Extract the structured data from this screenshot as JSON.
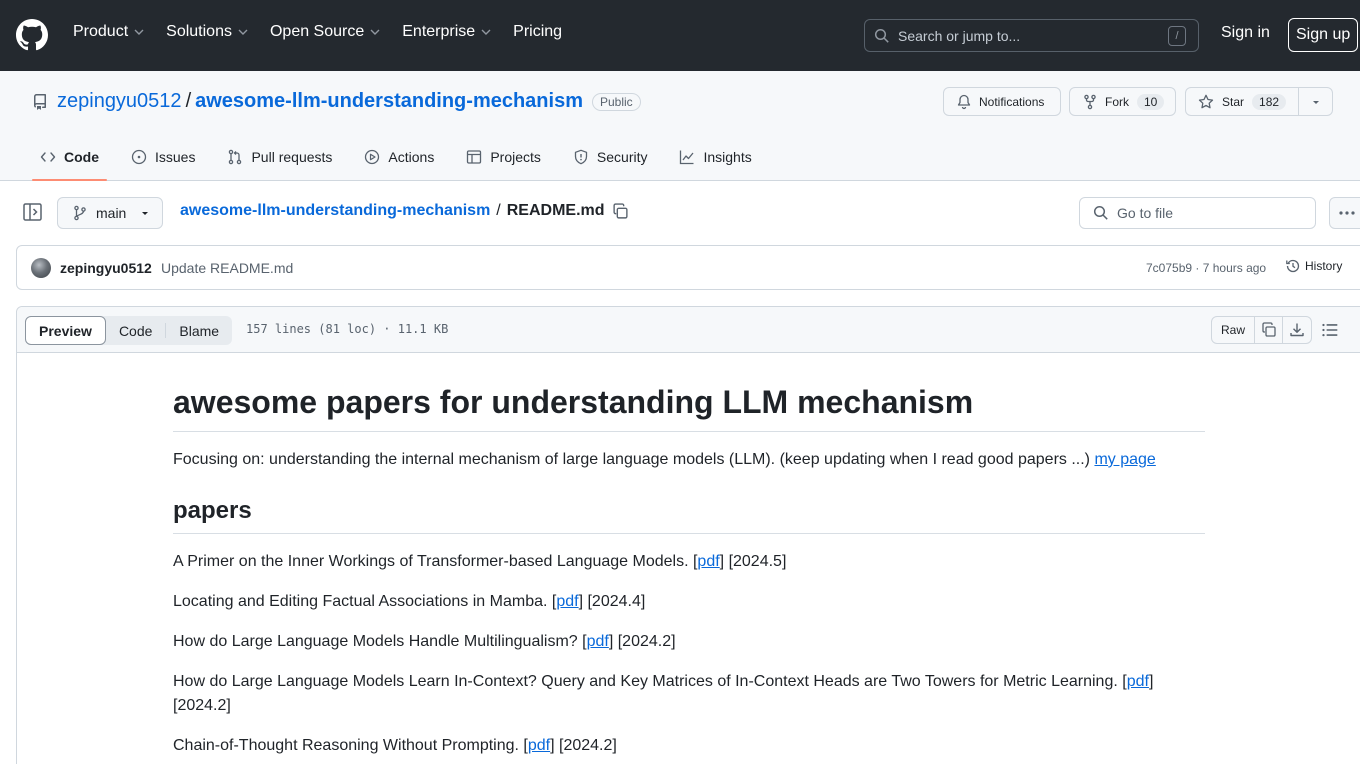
{
  "header": {
    "nav": [
      {
        "label": "Product",
        "has_menu": true
      },
      {
        "label": "Solutions",
        "has_menu": true
      },
      {
        "label": "Open Source",
        "has_menu": true
      },
      {
        "label": "Enterprise",
        "has_menu": true
      },
      {
        "label": "Pricing",
        "has_menu": false
      }
    ],
    "search_placeholder": "Search or jump to...",
    "search_shortcut": "/",
    "sign_in": "Sign in",
    "sign_up": "Sign up"
  },
  "repo": {
    "owner": "zepingyu0512",
    "separator": "/",
    "name": "awesome-llm-understanding-mechanism",
    "visibility": "Public",
    "notifications_label": "Notifications",
    "fork_label": "Fork",
    "fork_count": "10",
    "star_label": "Star",
    "star_count": "182",
    "tabs": [
      {
        "label": "Code",
        "icon": "code-icon",
        "active": true
      },
      {
        "label": "Issues",
        "icon": "issue-opened-icon",
        "active": false
      },
      {
        "label": "Pull requests",
        "icon": "git-pull-request-icon",
        "active": false
      },
      {
        "label": "Actions",
        "icon": "play-icon",
        "active": false
      },
      {
        "label": "Projects",
        "icon": "table-icon",
        "active": false
      },
      {
        "label": "Security",
        "icon": "shield-icon",
        "active": false
      },
      {
        "label": "Insights",
        "icon": "graph-icon",
        "active": false
      }
    ]
  },
  "file_nav": {
    "branch": "main",
    "breadcrumb_repo": "awesome-llm-understanding-mechanism",
    "breadcrumb_sep": "/",
    "file_name": "README.md",
    "go_to_file_placeholder": "Go to file"
  },
  "commit": {
    "author": "zepingyu0512",
    "message": "Update README.md",
    "meta": "7c075b9 · 7 hours ago",
    "history_label": "History"
  },
  "file_view": {
    "modes": [
      "Preview",
      "Code",
      "Blame"
    ],
    "active_mode": "Preview",
    "stats": "157 lines (81 loc) · 11.1 KB",
    "raw_label": "Raw"
  },
  "readme": {
    "title": "awesome papers for understanding LLM mechanism",
    "intro_text": "Focusing on: understanding the internal mechanism of large language models (LLM). (keep updating when I read good papers ...) ",
    "intro_link": "my page",
    "section_title": "papers",
    "papers": [
      {
        "title": "A Primer on the Inner Workings of Transformer-based Language Models. [",
        "link": "pdf",
        "date": "] [2024.5]"
      },
      {
        "title": "Locating and Editing Factual Associations in Mamba. [",
        "link": "pdf",
        "date": "] [2024.4]"
      },
      {
        "title": "How do Large Language Models Handle Multilingualism? [",
        "link": "pdf",
        "date": "] [2024.2]"
      },
      {
        "title": "How do Large Language Models Learn In-Context? Query and Key Matrices of In-Context Heads are Two Towers for Metric Learning. [",
        "link": "pdf",
        "date": "] [2024.2]"
      },
      {
        "title": "Chain-of-Thought Reasoning Without Prompting. [",
        "link": "pdf",
        "date": "] [2024.2]"
      }
    ]
  },
  "colors": {
    "header_bg": "#24292f",
    "link": "#0969da",
    "active_tab_underline": "#fd8c73",
    "border": "#d0d7de",
    "muted_text": "#59636e"
  }
}
